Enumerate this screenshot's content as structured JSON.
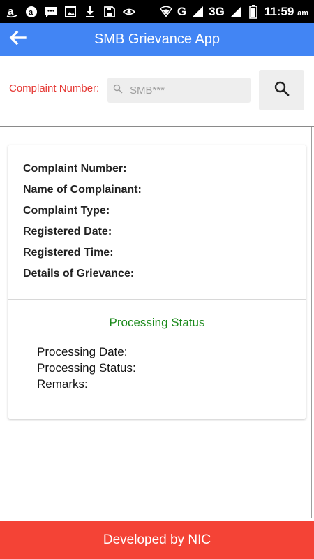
{
  "status_bar": {
    "network": "3G",
    "carrier_letter": "G",
    "time": "11:59",
    "ampm": "am",
    "icons": [
      "amazon-icon",
      "a-circle-icon",
      "message-icon",
      "image-icon",
      "download-icon",
      "save-icon",
      "eye-icon",
      "wifi-icon",
      "signal-icon",
      "battery-icon"
    ]
  },
  "app_bar": {
    "title": "SMB Grievance App",
    "back_icon": "arrow-left-icon"
  },
  "search": {
    "label": "Complaint Number:",
    "placeholder": "SMB***",
    "button_icon": "search-icon"
  },
  "details": {
    "complaint_number_label": "Complaint Number:",
    "complainant_name_label": "Name of Complainant:",
    "complaint_type_label": "Complaint Type:",
    "registered_date_label": "Registered Date:",
    "registered_time_label": "Registered Time:",
    "grievance_details_label": "Details of Grievance:"
  },
  "processing": {
    "title": "Processing Status",
    "date_label": "Processing Date:",
    "status_label": "Processing Status:",
    "remarks_label": "Remarks:"
  },
  "footer": {
    "text": "Developed by NIC"
  },
  "colors": {
    "app_bar": "#4285f4",
    "footer": "#f44336",
    "label_red": "#e53935",
    "status_green": "#1b8a1b"
  }
}
